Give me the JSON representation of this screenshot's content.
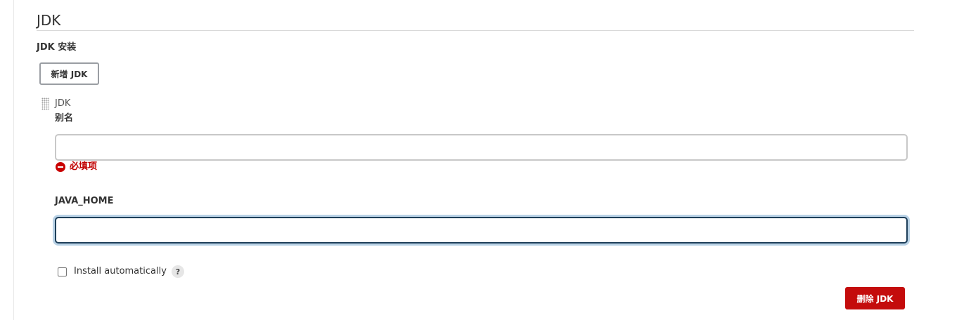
{
  "section": {
    "title": "JDK"
  },
  "installations": {
    "heading": "JDK 安装",
    "add_button_label": "新增 JDK"
  },
  "jdk_item": {
    "label": "JDK",
    "alias": {
      "label": "别名",
      "value": "",
      "placeholder": "",
      "error": "必填项"
    },
    "java_home": {
      "label": "JAVA_HOME",
      "value": "",
      "placeholder": ""
    },
    "install_automatically": {
      "label": "Install automatically",
      "checked": false,
      "help_glyph": "?"
    },
    "delete_button_label": "删除 JDK"
  },
  "icons": {
    "error": "error-circle-icon",
    "help": "help-icon",
    "drag": "drag-handle-icon"
  },
  "colors": {
    "error": "#c00000",
    "delete_button": "#c40c0c",
    "focus_border": "#1e3f5a",
    "focus_ring": "#b9d2e6"
  }
}
